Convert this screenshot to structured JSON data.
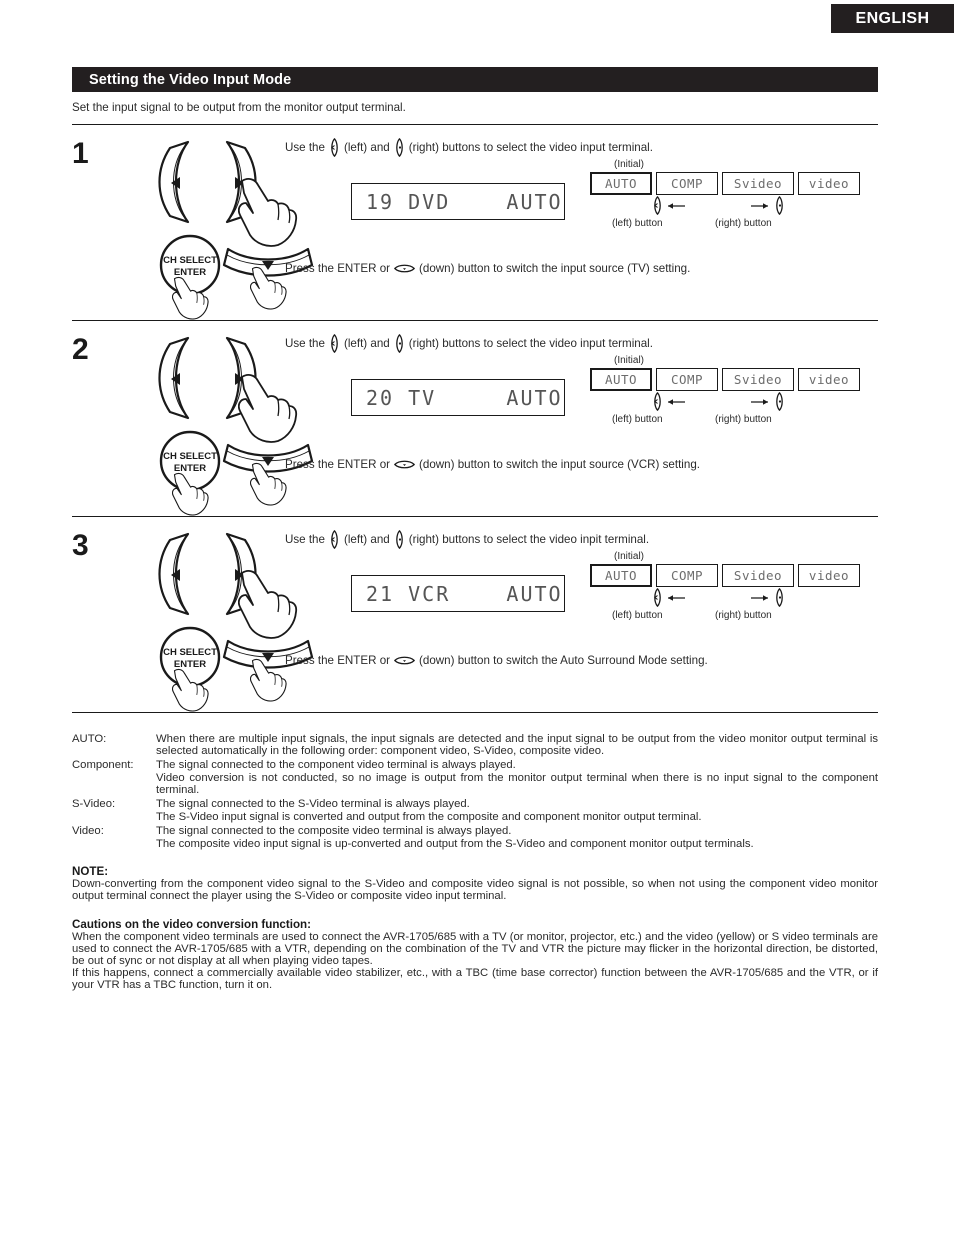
{
  "language_badge": "ENGLISH",
  "section": {
    "title": "Setting the Video Input Mode",
    "intro": "Set the input signal to be output from the monitor output terminal."
  },
  "glyph_names": {
    "left": "cursor-left-button-glyph",
    "right": "cursor-right-button-glyph",
    "down": "cursor-down-button-glyph"
  },
  "option_panel": {
    "initial_label": "(Initial)",
    "options": [
      "AUTO",
      "COMP",
      "Svideo",
      "video"
    ],
    "left_button_label": "(left) button",
    "right_button_label": "(right) button"
  },
  "remote": {
    "enter_button_line1": "CH SELECT",
    "enter_button_line2": "ENTER"
  },
  "steps": [
    {
      "number": "1",
      "use_prefix": "Use the",
      "use_mid": "(left) and",
      "use_suffix": "(right) buttons to select the video input terminal.",
      "lcd": "19 DVD    AUTO",
      "press_prefix": "Press the ENTER or",
      "press_suffix": "(down) button to switch the input source (TV) setting."
    },
    {
      "number": "2",
      "use_prefix": "Use the",
      "use_mid": "(left) and",
      "use_suffix": "(right) buttons to select the video input terminal.",
      "lcd": "20 TV     AUTO",
      "press_prefix": "Press the ENTER or",
      "press_suffix": "(down) button to switch the input source (VCR) setting."
    },
    {
      "number": "3",
      "use_prefix": "Use the",
      "use_mid": "(left) and",
      "use_suffix": "(right) buttons to select the video inpit terminal.",
      "lcd": "21 VCR    AUTO",
      "press_prefix": "Press the ENTER or",
      "press_suffix": "(down) button to switch the Auto Surround Mode setting."
    }
  ],
  "definitions": [
    {
      "term": "AUTO:",
      "lines": [
        "When there are multiple input signals, the input signals are detected and the input signal to be output from the video monitor output terminal is selected automatically in the following order: component video, S-Video, composite video."
      ]
    },
    {
      "term": "Component:",
      "lines": [
        "The signal connected to the component video terminal is always played.",
        "Video conversion is not conducted, so no image is output from the monitor output terminal when there is no input signal to the component terminal."
      ]
    },
    {
      "term": "S-Video:",
      "lines": [
        "The signal connected to the S-Video terminal is always played.",
        "The S-Video input signal is converted and output from the composite and component monitor output terminal."
      ]
    },
    {
      "term": "Video:",
      "lines": [
        "The signal connected to the composite video terminal is always played.",
        "The composite video input signal is up-converted and output from the S-Video and component monitor output terminals."
      ]
    }
  ],
  "note": {
    "heading": "NOTE:",
    "text": "Down-converting from the component video signal to the S-Video and composite video signal is not possible, so when not using the component video monitor output terminal connect the player using the S-Video or composite video input terminal."
  },
  "caution": {
    "heading": "Cautions on the video conversion function:",
    "paragraph1": "When the component video terminals are used to connect the AVR-1705/685 with a TV (or monitor, projector, etc.) and the video (yellow) or S video terminals are used to connect the AVR-1705/685 with a VTR, depending on the combination of the TV and VTR the picture may flicker in the horizontal direction, be distorted, be out of sync or not display at all when playing video tapes.",
    "paragraph2": "If this happens, connect a commercially available video stabilizer, etc., with a TBC (time base corrector) function between the AVR-1705/685 and the VTR, or if your VTR has a TBC function, turn it on."
  },
  "colors": {
    "bar_background": "#231f20",
    "bar_text": "#ffffff",
    "body_text": "#2b2b2b",
    "lcd_text": "#555555"
  }
}
